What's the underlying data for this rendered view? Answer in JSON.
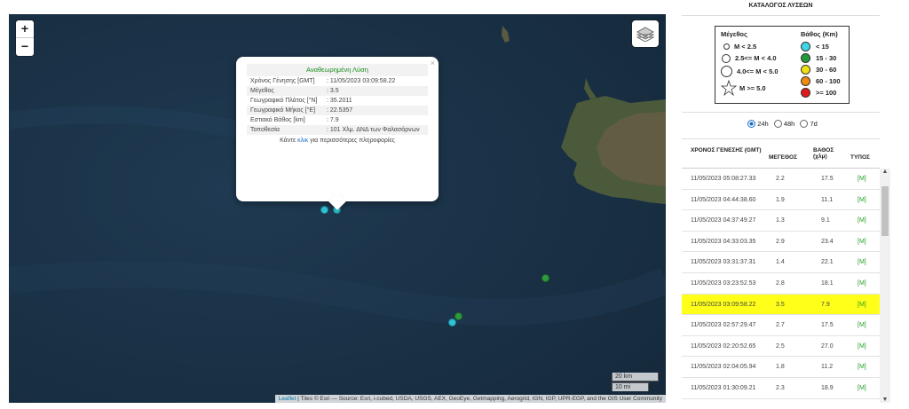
{
  "map": {
    "zoom_in": "+",
    "zoom_out": "−",
    "popup": {
      "title": "Αναθεωρημένη Λύση",
      "close": "×",
      "rows": [
        {
          "key": "Χρόνος Γένησης [GMT]",
          "value": ": 11/05/2023 03:09:58.22"
        },
        {
          "key": "Μέγεθος",
          "value": ": 3.5"
        },
        {
          "key": "Γεωγραφικό Πλάτος [°N]",
          "value": ": 35.2011"
        },
        {
          "key": "Γεωγραφικό Μήκος [°E]",
          "value": ": 22.5357"
        },
        {
          "key": "Εστιακό Βάθος [km]",
          "value": ": 7.9"
        },
        {
          "key": "Τοποθεσία",
          "value": ": 101 Χλμ. ΔΝΔ των Φαλασάρνων"
        }
      ],
      "more_prefix": "Κάντε ",
      "more_link": "κλικ",
      "more_suffix": " για περισσότερες πληροφορίες"
    },
    "quakes": [
      {
        "color": "#2ec4d6"
      },
      {
        "color": "#2ec4d6"
      },
      {
        "color": "#2e9a3e"
      },
      {
        "color": "#2e9a3e"
      },
      {
        "color": "#2ec4d6"
      }
    ],
    "scale_km": "20 km",
    "scale_mi": "10 mi",
    "attribution_link": "Leaflet",
    "attribution_text": " | Tiles © Esri — Source: Esri, i-cubed, USDA, USGS, AEX, GeoEye, Getmapping, Aerogrid, IGN, IGP, UPR-EGP, and the GIS User Community"
  },
  "panel": {
    "title": "ΚΑΤΑΛΟΓΟΣ ΛΥΣΕΩΝ",
    "legend": {
      "magnitude_head": "Μέγεθος",
      "magnitudes": [
        "M < 2.5",
        "2.5<= M < 4.0",
        "4.0<= M < 5.0",
        "M >= 5.0"
      ],
      "depth_head": "Βάθος (Km)",
      "depths": [
        {
          "label": "< 15",
          "color": "#3fd6e6"
        },
        {
          "label": "15 - 30",
          "color": "#239a3a"
        },
        {
          "label": "30 - 60",
          "color": "#f0e010"
        },
        {
          "label": "60 - 100",
          "color": "#f08a10"
        },
        {
          "label": ">= 100",
          "color": "#e01a1a"
        }
      ]
    },
    "periods": [
      "24h",
      "48h",
      "7d"
    ],
    "columns": {
      "time": "ΧΡΟΝΟΣ ΓΕΝΕΣΗΣ (GMT)",
      "mag": "ΜΕΓΕΘΟΣ",
      "depth": "ΒΑΘΟΣ (χλμ)",
      "type": "ΤΥΠΟΣ"
    },
    "rows": [
      {
        "time": "11/05/2023 05:08:27.33",
        "mag": "2.2",
        "depth": "17.5",
        "type": "[M]"
      },
      {
        "time": "11/05/2023 04:44:38.60",
        "mag": "1.9",
        "depth": "11.1",
        "type": "[M]"
      },
      {
        "time": "11/05/2023 04:37:49.27",
        "mag": "1.3",
        "depth": "9.1",
        "type": "[M]"
      },
      {
        "time": "11/05/2023 04:33:03.35",
        "mag": "2.9",
        "depth": "23.4",
        "type": "[M]"
      },
      {
        "time": "11/05/2023 03:31:37.31",
        "mag": "1.4",
        "depth": "22.1",
        "type": "[M]"
      },
      {
        "time": "11/05/2023 03:23:52.53",
        "mag": "2.8",
        "depth": "18.1",
        "type": "[M]"
      },
      {
        "time": "11/05/2023 03:09:58.22",
        "mag": "3.5",
        "depth": "7.9",
        "type": "[M]"
      },
      {
        "time": "11/05/2023 02:57:29.47",
        "mag": "2.7",
        "depth": "17.5",
        "type": "[M]"
      },
      {
        "time": "11/05/2023 02:20:52.65",
        "mag": "2.5",
        "depth": "27.0",
        "type": "[M]"
      },
      {
        "time": "11/05/2023 02:04:05.94",
        "mag": "1.8",
        "depth": "11.2",
        "type": "[M]"
      },
      {
        "time": "11/05/2023 01:30:09.21",
        "mag": "2.3",
        "depth": "18.9",
        "type": "[M]"
      }
    ]
  }
}
